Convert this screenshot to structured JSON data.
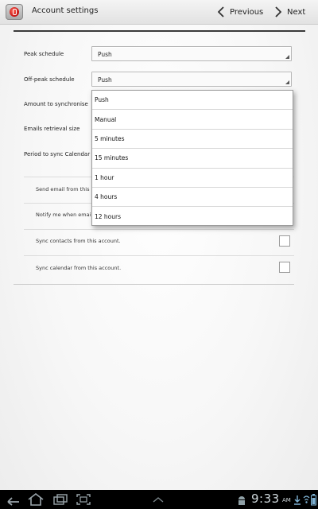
{
  "header": {
    "title": "Account settings",
    "previous_label": "Previous",
    "next_label": "Next"
  },
  "settings": {
    "peak_schedule": {
      "label": "Peak schedule",
      "value": "Push"
    },
    "off_peak_schedule": {
      "label": "Off-peak schedule",
      "value": "Push"
    },
    "amount_to_synchronise": {
      "label": "Amount to synchronise"
    },
    "emails_retrieval_size": {
      "label": "Emails retrieval size"
    },
    "period_to_sync_calendar": {
      "label": "Period to sync Calendar"
    }
  },
  "dropdown": {
    "options": [
      "Push",
      "Manual",
      "5 minutes",
      "15 minutes",
      "1 hour",
      "4 hours",
      "12 hours"
    ]
  },
  "checkbox_rows": [
    {
      "label": "Send email from this",
      "checked": false
    },
    {
      "label": "Notify me when emai",
      "checked": false
    },
    {
      "label": "Sync contacts from this account.",
      "checked": false
    },
    {
      "label": "Sync calendar from this account.",
      "checked": false
    }
  ],
  "status_bar": {
    "time": "9:33",
    "ampm": "AM",
    "icons": [
      "back-icon",
      "home-icon",
      "recent-apps-icon",
      "screenshot-icon",
      "up-chevron-icon",
      "android-debug-icon",
      "download-icon",
      "wifi-icon",
      "battery-icon"
    ]
  },
  "colors": {
    "accent_red": "#c40f0f",
    "status_bar_bg": "#000000",
    "divider_dark": "#3a3a3a"
  }
}
